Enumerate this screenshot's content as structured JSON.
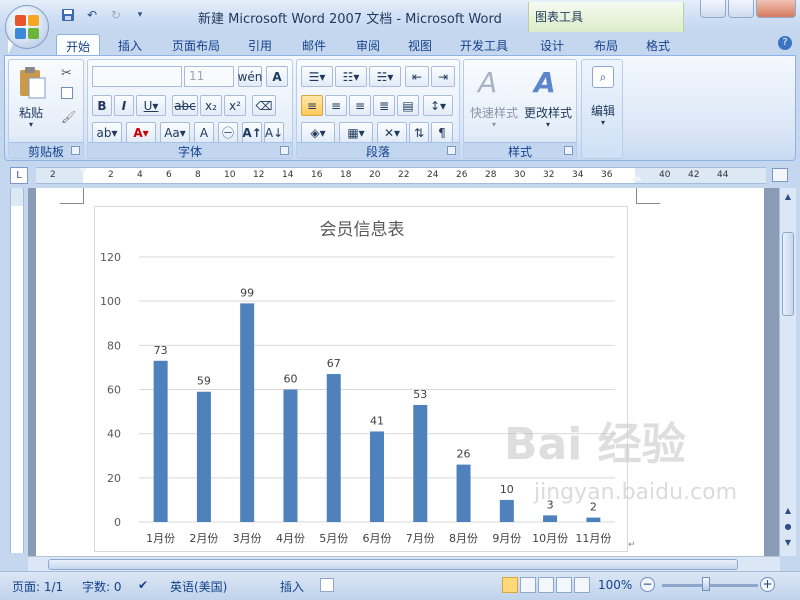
{
  "title_bar": {
    "window_title": "新建 Microsoft Word 2007 文档 - Microsoft Word",
    "context_tab_group": "图表工具"
  },
  "tabs": [
    "开始",
    "插入",
    "页面布局",
    "引用",
    "邮件",
    "审阅",
    "视图",
    "开发工具",
    "设计",
    "布局",
    "格式"
  ],
  "ribbon": {
    "clipboard": {
      "paste_label": "粘贴",
      "group_label": "剪贴板"
    },
    "font": {
      "font_name": "",
      "font_size": "11",
      "group_label": "字体"
    },
    "paragraph": {
      "group_label": "段落"
    },
    "styles": {
      "quick_styles": "快速样式",
      "change_styles": "更改样式",
      "group_label": "样式"
    },
    "editing": {
      "label": "编辑"
    }
  },
  "ruler": {
    "numbers": [
      "2",
      "2",
      "4",
      "6",
      "8",
      "10",
      "12",
      "14",
      "16",
      "18",
      "20",
      "22",
      "24",
      "26",
      "28",
      "30",
      "32",
      "34",
      "36",
      "40",
      "42",
      "44"
    ]
  },
  "status_bar": {
    "page": "页面: 1/1",
    "words": "字数: 0",
    "language": "英语(美国)",
    "insert_mode": "插入",
    "zoom": "100%"
  },
  "watermark": {
    "line1": "Bai 经验",
    "line2": "jingyan.baidu.com"
  },
  "chart_data": {
    "type": "bar",
    "title": "会员信息表",
    "categories": [
      "1月份",
      "2月份",
      "3月份",
      "4月份",
      "5月份",
      "6月份",
      "7月份",
      "8月份",
      "9月份",
      "10月份",
      "11月份"
    ],
    "values": [
      73,
      59,
      99,
      60,
      67,
      41,
      53,
      26,
      10,
      3,
      2
    ],
    "ylim": [
      0,
      120
    ],
    "yticks": [
      0,
      20,
      40,
      60,
      80,
      100,
      120
    ],
    "bar_color": "#4f81bd",
    "grid": true,
    "data_labels": true
  }
}
